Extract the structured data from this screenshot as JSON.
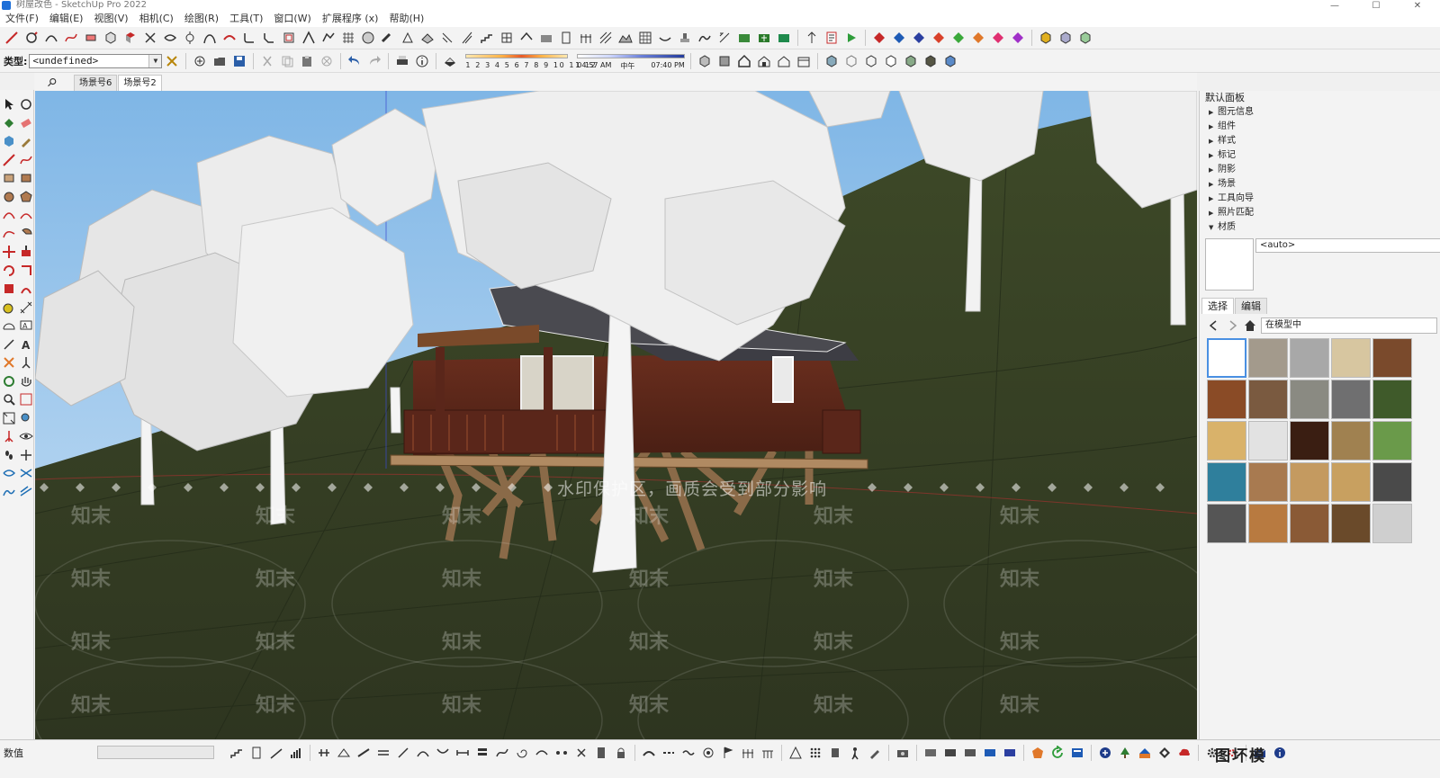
{
  "window": {
    "title": "树屋改色 - SketchUp Pro 2022",
    "buttons": [
      "—",
      "☐",
      "✕"
    ]
  },
  "menu": [
    "文件(F)",
    "编辑(E)",
    "视图(V)",
    "相机(C)",
    "绘图(R)",
    "工具(T)",
    "窗口(W)",
    "扩展程序 (x)",
    "帮助(H)"
  ],
  "toolbar": {
    "type_label": "类型:",
    "type_value": "<undefined>",
    "month_labels": "1 2 3 4 5 6 7 8 9 10 11 12",
    "time_start": "04:57 AM",
    "time_mid": "中午",
    "time_end": "07:40 PM"
  },
  "scenes": [
    "场景号6",
    "场景号2"
  ],
  "viewport": {
    "watermark_banner": "水印保护区，画质会受到部分影响",
    "watermark_text": "知末"
  },
  "tray": {
    "title": "默认面板",
    "panels": [
      {
        "label": "图元信息",
        "open": false
      },
      {
        "label": "组件",
        "open": false
      },
      {
        "label": "样式",
        "open": false
      },
      {
        "label": "标记",
        "open": false
      },
      {
        "label": "阴影",
        "open": false
      },
      {
        "label": "场景",
        "open": false
      },
      {
        "label": "工具向导",
        "open": false
      },
      {
        "label": "照片匹配",
        "open": false
      },
      {
        "label": "材质",
        "open": true
      }
    ],
    "material_name": "<auto>",
    "tabs": [
      "选择",
      "编辑"
    ],
    "collection": "在模型中",
    "swatches": [
      "#ffffff",
      "#a39a8c",
      "#a8a8a8",
      "#d7c6a0",
      "#7a4a2c",
      "#8a4b26",
      "#7a5a40",
      "#8a8a82",
      "#6f6f70",
      "#3f5a2a",
      "#d9b26a",
      "#e2e2e2",
      "#3a1e12",
      "#a08150",
      "#6a9a4a",
      "#2f7f9c",
      "#a87a50",
      "#c49a60",
      "#c8a060",
      "#4a4a4a",
      "#555555",
      "#b87a40",
      "#8a5a36",
      "#6a4a2a",
      "#cfcfcf"
    ]
  },
  "status": {
    "measure_label": "数值",
    "brand": [
      "图",
      "坏",
      "模"
    ]
  }
}
